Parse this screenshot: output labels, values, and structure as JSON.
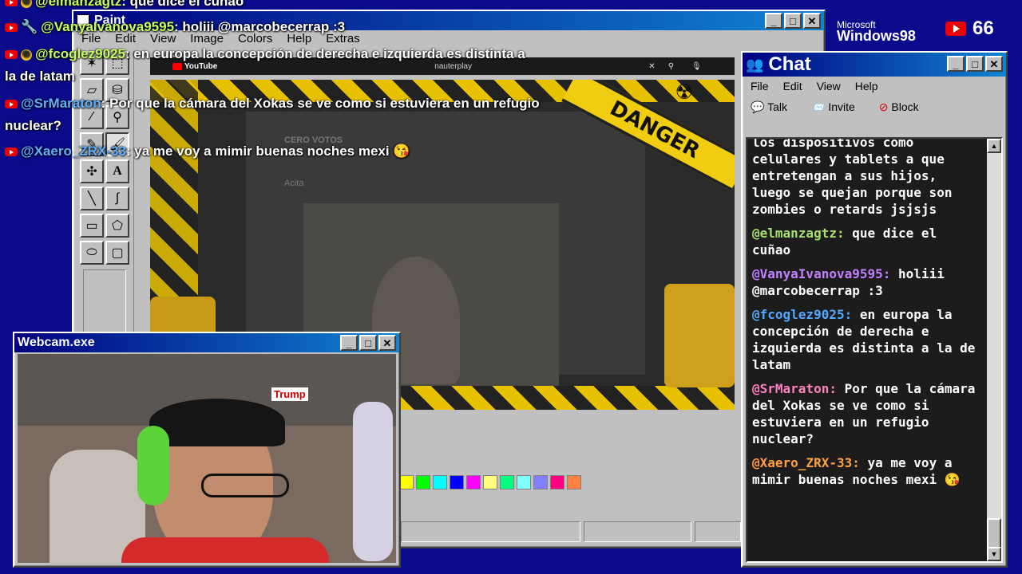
{
  "overlay_chat": [
    {
      "user": "@elmanzagtz",
      "text": ": que dice el cuñao"
    },
    {
      "user": "@VanyaIvanova9595",
      "text": ": holiii @marcobecerrap :3"
    },
    {
      "user": "@fcoglez9025",
      "text": ": en europa la concepción de derecha e izquierda es distinta a",
      "text2": "la de latam"
    },
    {
      "user": "@SrMaraton",
      "text": ": Por que la cámara del Xokas se ve como si estuviera en un refugio",
      "text2": "nuclear?"
    },
    {
      "user": "@Xaero_ZRX-33",
      "text": ": ya me voy a mimir buenas noches mexi 😘"
    }
  ],
  "branding": {
    "ms_small": "Microsoft",
    "win98": "Windows98",
    "viewer_count": "66"
  },
  "paint": {
    "title": "Paint",
    "menu": [
      "File",
      "Edit",
      "View",
      "Image",
      "Colors",
      "Help",
      "Extras"
    ],
    "palette": [
      "#ffff00",
      "#00ff00",
      "#00ffff",
      "#0000ff",
      "#ff00ff",
      "#ffff80",
      "#00ff80",
      "#80ffff",
      "#8080ff",
      "#ff0080",
      "#ff8040"
    ]
  },
  "stream": {
    "yt_logo": "YouTube",
    "search_value": "nauterplay",
    "danger_text": "DANGER",
    "bg_texts": [
      "CERO VOTOS",
      "Acita"
    ]
  },
  "webcam": {
    "title": "Webcam.exe",
    "shelf_text": "Trump"
  },
  "chat": {
    "title": "Chat",
    "menu": [
      "File",
      "Edit",
      "View",
      "Help"
    ],
    "tools": {
      "talk": "Talk",
      "invite": "Invite",
      "block": "Block"
    },
    "messages": [
      {
        "user": "",
        "text": "los dispositivos como celulares y tablets a que entretengan a sus hijos, luego se quejan porque son zombies o retards jsjsjs",
        "color": "#ffffff"
      },
      {
        "user": "@elmanzagtz:",
        "text": "que dice el cuñao",
        "color": "#a8e070"
      },
      {
        "user": "@VanyaIvanova9595:",
        "text": "holiii @marcobecerrap :3",
        "color": "#c080ff"
      },
      {
        "user": "@fcoglez9025:",
        "text": "en europa la concepción de derecha e izquierda es distinta a la de latam",
        "color": "#50a8ff"
      },
      {
        "user": "@SrMaraton:",
        "text": "Por que la cámara del Xokas se ve como si estuviera en un refugio nuclear?",
        "color": "#ff80c0"
      },
      {
        "user": "@Xaero_ZRX-33:",
        "text": "ya me voy a mimir buenas noches mexi 😘",
        "color": "#ffa040"
      }
    ]
  }
}
